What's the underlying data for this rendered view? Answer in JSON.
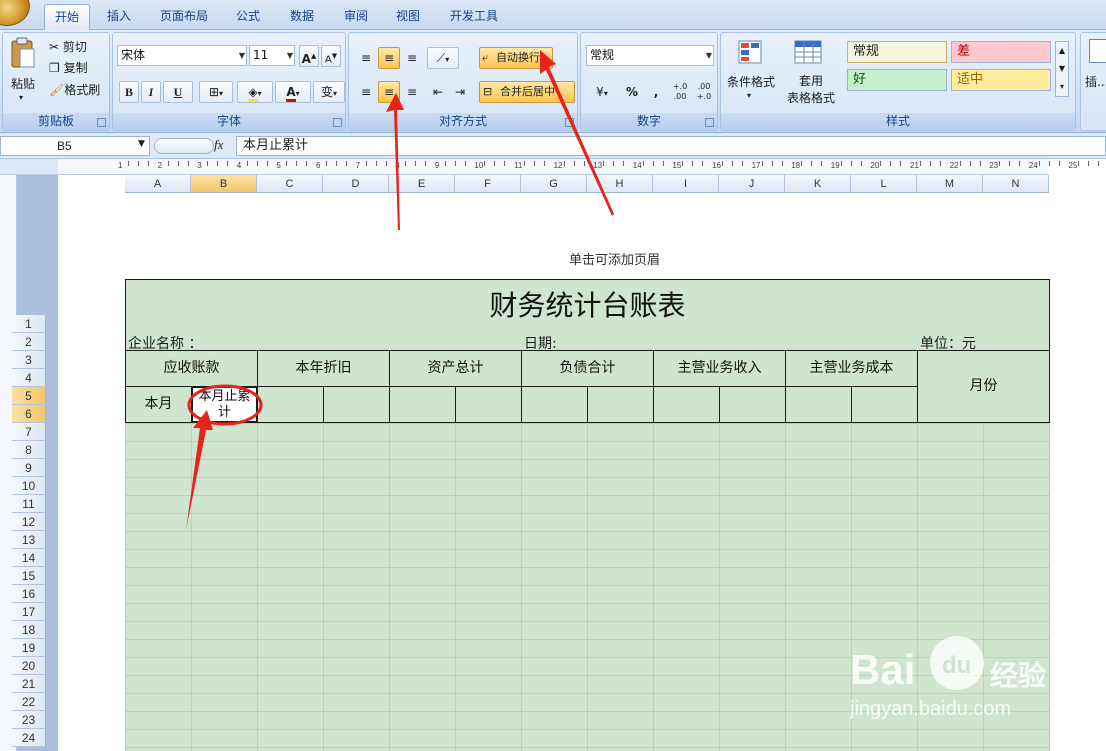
{
  "ribbon": {
    "tabs": [
      "开始",
      "插入",
      "页面布局",
      "公式",
      "数据",
      "审阅",
      "视图",
      "开发工具"
    ],
    "clipboard": {
      "paste": "粘贴",
      "cut": "剪切",
      "copy": "复制",
      "format_painter": "格式刷",
      "group": "剪贴板"
    },
    "font": {
      "name": "宋体",
      "size": "11",
      "bold": "B",
      "italic": "I",
      "underline": "U",
      "color": "A",
      "phonetic": "变",
      "group": "字体"
    },
    "alignment": {
      "wrap_text": "自动换行",
      "merge_center": "合并后居中",
      "group": "对齐方式"
    },
    "number": {
      "format": "常规",
      "percent": "%",
      "comma": ",",
      "inc_decimal": "+.0 .00",
      "dec_decimal": ".00 +.0",
      "group": "数字"
    },
    "styles": {
      "conditional": "条件格式",
      "table_format": "套用\n表格格式",
      "normal": "常规",
      "bad": "差",
      "good": "好",
      "neutral": "适中",
      "group": "样式"
    },
    "cells": {
      "insert": "插..."
    }
  },
  "formula_bar": {
    "name_box": "B5",
    "fx": "fx",
    "content": "本月止累计"
  },
  "ruler": {
    "numbers": [
      "1",
      "2",
      "3",
      "4",
      "5",
      "6",
      "7",
      "8",
      "9",
      "10",
      "11",
      "12",
      "13",
      "14",
      "15",
      "16",
      "17",
      "18",
      "19",
      "20",
      "21",
      "22",
      "23",
      "24",
      "25"
    ]
  },
  "columns": [
    "A",
    "B",
    "C",
    "D",
    "E",
    "F",
    "G",
    "H",
    "I",
    "J",
    "K",
    "L",
    "M",
    "N"
  ],
  "rows": [
    "1",
    "2",
    "3",
    "4",
    "5",
    "6",
    "7",
    "8",
    "9",
    "10",
    "11",
    "12",
    "13",
    "14",
    "15",
    "16",
    "17",
    "18",
    "19",
    "20",
    "21",
    "22",
    "23",
    "24"
  ],
  "page": {
    "header_hint": "单击可添加页眉"
  },
  "table": {
    "title": "财务统计台账表",
    "company_label": "企业名称 ：",
    "date_label": "日期:",
    "unit_label": "单位：元",
    "headers": [
      "应收账款",
      "本年折旧",
      "资产总计",
      "负债合计",
      "主营业务收入",
      "主营业务成本",
      "月份"
    ],
    "sub_this_month": "本月",
    "sub_cumulative": "本月止累计"
  },
  "watermark": {
    "brand": "Bai",
    "brand2": "经验",
    "url": "jingyan.baidu.com"
  },
  "colors": {
    "accent": "#e8231b",
    "sheet_fill": "#cfe5cf",
    "ribbon": "#dbe8f7"
  }
}
